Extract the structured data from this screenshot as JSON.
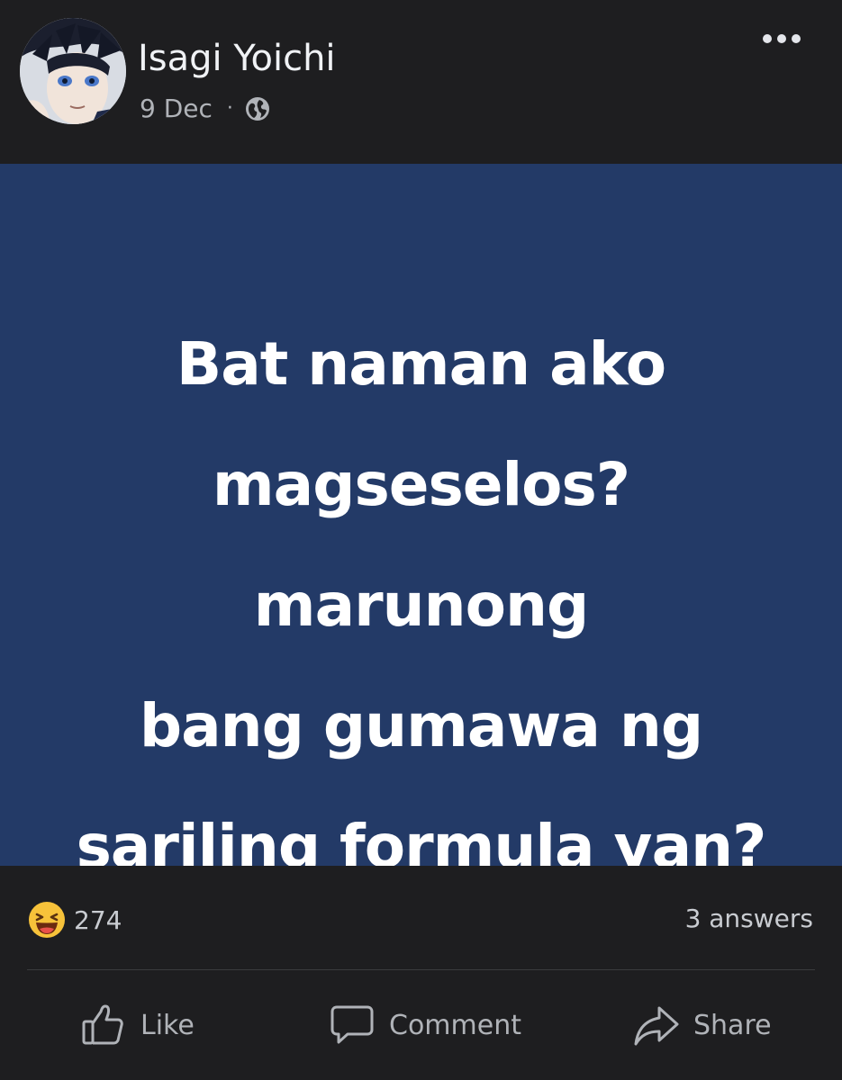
{
  "post": {
    "author": "Isagi Yoichi",
    "date": "9 Dec",
    "privacy_icon": "globe-icon",
    "text_lines": [
      "Bat naman ako",
      "magseselos?marunong",
      "bang gumawa ng",
      "sariling formula yan?"
    ],
    "background_color": "#233a67"
  },
  "stats": {
    "reaction_icon": "laughing-emoji-icon",
    "reaction_count": "274",
    "answers": "3 answers"
  },
  "actions": {
    "like": "Like",
    "comment": "Comment",
    "share": "Share"
  }
}
